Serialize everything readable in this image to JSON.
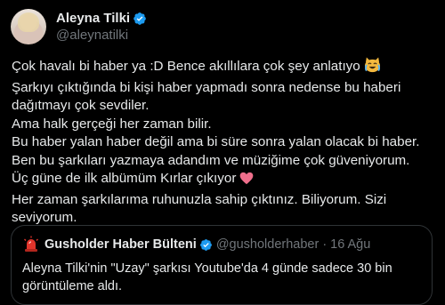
{
  "author": {
    "display_name": "Aleyna Tilki",
    "handle": "@aleynatilki",
    "avatar_icon": "profile-photo",
    "verified_icon": "verified-badge-icon",
    "verified_color": "#1d9bf0"
  },
  "tweet": {
    "lines": [
      "Çok havalı bi haber ya :D Bence akıllılara çok şey anlatıyo",
      "Şarkıyı çıktığında bi kişi haber yapmadı sonra nedense bu haberi",
      "dağıtmayı çok sevdiler.",
      "Ama halk gerçeği her zaman bilir.",
      "Bu haber yalan haber değil ama bi süre sonra yalan olacak bi haber.",
      "Ben bu şarkıları yazmaya adandım ve müziğime çok güveniyorum.",
      "Üç güne de ilk albümüm Kırlar çıkıyor",
      "Her zaman şarkılarıma ruhunuzla sahip çıktınız. Biliyorum. Sizi",
      "seviyorum."
    ],
    "emoji_laugh": "laughing-crying-cat-emoji",
    "emoji_heart": "heart-emoji"
  },
  "quote": {
    "display_name": "Gusholder Haber Bülteni",
    "handle": "@gusholderhaber",
    "separator": "·",
    "date": "16 Ağu",
    "avatar_icon": "alarm-siren-icon",
    "text": "Aleyna Tilki'nin \"Uzay\" şarkısı Youtube'da 4 günde sadece 30 bin görüntüleme aldı."
  },
  "colors": {
    "background": "#000000",
    "text": "#e7e9ea",
    "secondary": "#71767b",
    "border": "#2f3336"
  }
}
